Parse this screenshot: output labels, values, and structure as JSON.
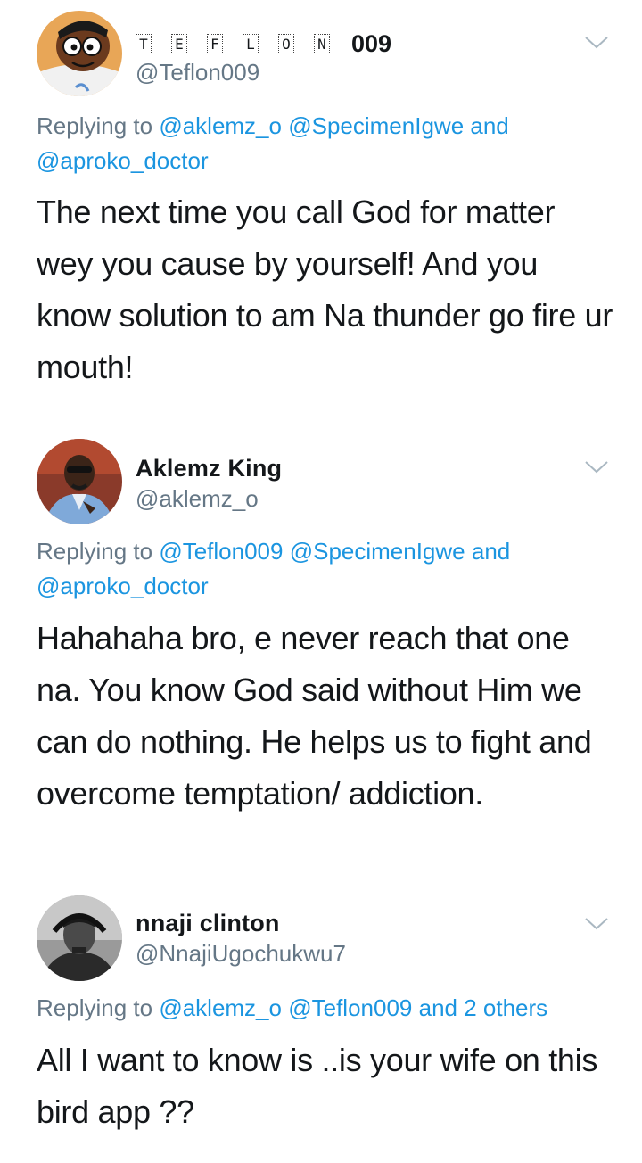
{
  "tweets": [
    {
      "display_name_letters": [
        "T",
        "E",
        "F",
        "L",
        "O",
        "N"
      ],
      "display_name_suffix": "009",
      "handle": "@Teflon009",
      "reply_prefix": "Replying to",
      "reply_m1": "@aklemz_o",
      "reply_m2": "@SpecimenIgwe",
      "reply_and": "and",
      "reply_m3": "@aproko_doctor",
      "text": "The next time you call God for matter wey you cause by yourself! And you know solution to am Na thunder go fire ur mouth!",
      "avatar_icon": "cartoon-avatar-icon"
    },
    {
      "display_name": "Aklemz King",
      "handle": "@aklemz_o",
      "reply_prefix": "Replying to",
      "reply_m1": "@Teflon009",
      "reply_m2": "@SpecimenIgwe",
      "reply_and": "and",
      "reply_m3": "@aproko_doctor",
      "text": "Hahahaha bro, e never reach that one na. You know God said without Him we can do nothing. He helps us to fight and overcome temptation/ addiction.",
      "avatar_icon": "user-photo-avatar"
    },
    {
      "display_name": "nnaji clinton",
      "handle": "@NnajiUgochukwu7",
      "reply_prefix": "Replying to",
      "reply_m1": "@aklemz_o",
      "reply_m2": "@Teflon009",
      "reply_and": "and",
      "reply_m3": "2 others",
      "text": "All I want to know is ..is your wife on this bird app ??",
      "avatar_icon": "user-photo-avatar"
    }
  ],
  "colors": {
    "name": "#14171a",
    "muted": "#657786",
    "link": "#1b95e0"
  }
}
